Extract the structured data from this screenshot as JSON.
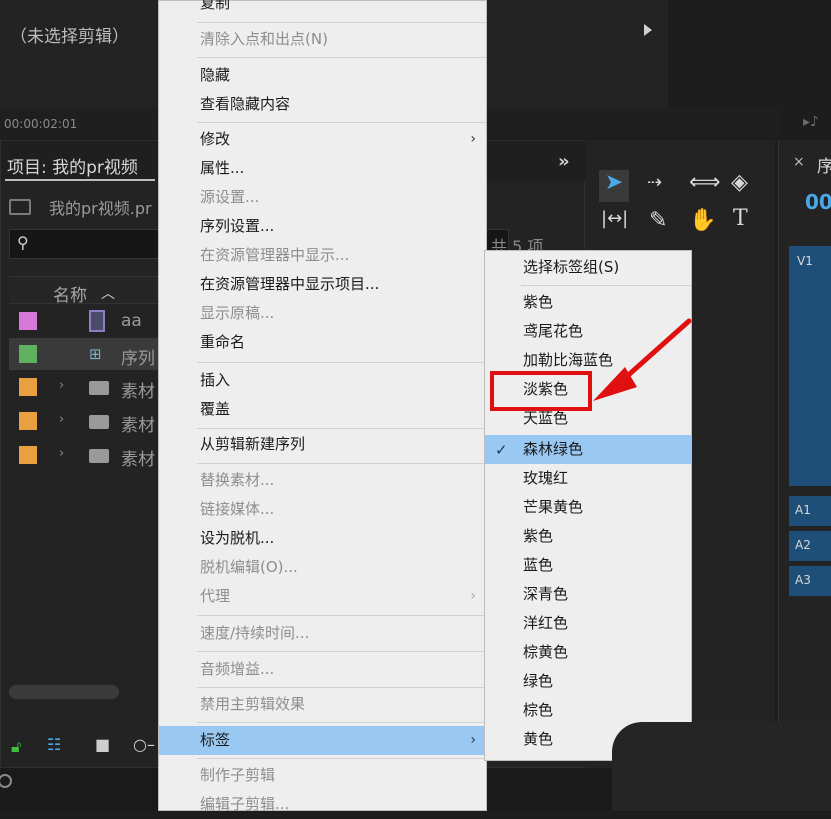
{
  "source_monitor": {
    "title": "（未选择剪辑）",
    "timecode": "00:00:02:01"
  },
  "project_panel": {
    "tab_label": "项目: 我的pr视频",
    "file_label": "我的pr视频.pr",
    "item_count": "共 5 项",
    "column_header": "名称",
    "rows": [
      {
        "name": "aa",
        "kind": "clip",
        "color": "#d878d8"
      },
      {
        "name": "序列",
        "kind": "sequence",
        "color": "#5fb05f"
      },
      {
        "name": "素材",
        "kind": "folder",
        "color": "#e8a040"
      },
      {
        "name": "素材",
        "kind": "folder",
        "color": "#e8a040"
      },
      {
        "name": "素材",
        "kind": "folder",
        "color": "#e8a040"
      }
    ]
  },
  "timeline": {
    "tab_label": "序",
    "timecode": "00",
    "tracks": [
      "V1",
      "A1",
      "A2",
      "A3"
    ]
  },
  "tools": [
    "selection-tool",
    "track-select-tool",
    "ripple-edit-tool",
    "razor-tool",
    "slip-tool",
    "pen-tool",
    "hand-tool",
    "type-tool"
  ],
  "context_menu": {
    "items": [
      {
        "label": "复制",
        "disabled": false
      },
      {
        "label": "清除入点和出点(N)",
        "disabled": true
      },
      {
        "label": "隐藏",
        "disabled": false
      },
      {
        "label": "查看隐藏内容",
        "disabled": false
      },
      {
        "label": "修改",
        "disabled": false,
        "submenu": true
      },
      {
        "label": "属性...",
        "disabled": false
      },
      {
        "label": "源设置...",
        "disabled": true
      },
      {
        "label": "序列设置...",
        "disabled": false
      },
      {
        "label": "在资源管理器中显示...",
        "disabled": true
      },
      {
        "label": "在资源管理器中显示项目...",
        "disabled": false
      },
      {
        "label": "显示原稿...",
        "disabled": true
      },
      {
        "label": "重命名",
        "disabled": false
      },
      {
        "label": "插入",
        "disabled": false
      },
      {
        "label": "覆盖",
        "disabled": false
      },
      {
        "label": "从剪辑新建序列",
        "disabled": false
      },
      {
        "label": "替换素材...",
        "disabled": true
      },
      {
        "label": "链接媒体...",
        "disabled": true
      },
      {
        "label": "设为脱机...",
        "disabled": false
      },
      {
        "label": "脱机编辑(O)...",
        "disabled": true
      },
      {
        "label": "代理",
        "disabled": true,
        "submenu": true
      },
      {
        "label": "速度/持续时间...",
        "disabled": true
      },
      {
        "label": "音频增益...",
        "disabled": true
      },
      {
        "label": "禁用主剪辑效果",
        "disabled": true
      },
      {
        "label": "标签",
        "disabled": false,
        "submenu": true,
        "highlighted": true
      },
      {
        "label": "制作子剪辑",
        "disabled": true
      },
      {
        "label": "编辑子剪辑...",
        "disabled": true
      }
    ]
  },
  "label_submenu": {
    "items": [
      {
        "label": "选择标签组(S)"
      },
      {
        "label": "紫色"
      },
      {
        "label": "鸢尾花色"
      },
      {
        "label": "加勒比海蓝色"
      },
      {
        "label": "淡紫色"
      },
      {
        "label": "天蓝色"
      },
      {
        "label": "森林绿色",
        "checked": true
      },
      {
        "label": "玫瑰红"
      },
      {
        "label": "芒果黄色"
      },
      {
        "label": "紫色"
      },
      {
        "label": "蓝色"
      },
      {
        "label": "深青色"
      },
      {
        "label": "洋红色"
      },
      {
        "label": "棕黄色"
      },
      {
        "label": "绿色"
      },
      {
        "label": "棕色"
      },
      {
        "label": "黄色"
      }
    ]
  },
  "colors": {
    "menu_bg": "#eeeeee",
    "highlight": "#99c9f2",
    "annotation": "#e01010",
    "accent_blue": "#4aa8e8"
  }
}
